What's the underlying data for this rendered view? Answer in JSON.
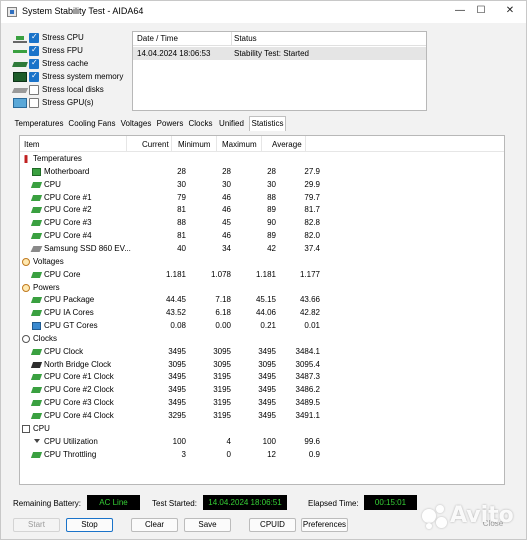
{
  "window": {
    "title": "System Stability Test - AIDA64",
    "controls": {
      "minimize": "—",
      "maximize": "☐",
      "close": "✕"
    }
  },
  "stress_options": [
    {
      "label": "Stress CPU",
      "checked": true,
      "icon": "cpu-icon"
    },
    {
      "label": "Stress FPU",
      "checked": true,
      "icon": "fpu-icon"
    },
    {
      "label": "Stress cache",
      "checked": true,
      "icon": "cache-icon"
    },
    {
      "label": "Stress system memory",
      "checked": true,
      "icon": "memory-icon"
    },
    {
      "label": "Stress local disks",
      "checked": false,
      "icon": "disk-icon"
    },
    {
      "label": "Stress GPU(s)",
      "checked": false,
      "icon": "gpu-icon"
    }
  ],
  "status_log": {
    "headers": [
      "Date / Time",
      "Status"
    ],
    "rows": [
      {
        "datetime": "14.04.2024 18:06:53",
        "status": "Stability Test: Started"
      }
    ]
  },
  "tabs": [
    "Temperatures",
    "Cooling Fans",
    "Voltages",
    "Powers",
    "Clocks",
    "Unified",
    "Statistics"
  ],
  "active_tab": "Statistics",
  "stats": {
    "headers": [
      "Item",
      "Current",
      "Minimum",
      "Maximum",
      "Average"
    ],
    "rows": [
      {
        "type": "group",
        "name": "Temperatures",
        "icon": "thermometer-icon"
      },
      {
        "type": "item",
        "name": "Motherboard",
        "icon": "motherboard-icon",
        "values": [
          "28",
          "28",
          "28",
          "27.9"
        ]
      },
      {
        "type": "item",
        "name": "CPU",
        "icon": "chip-icon",
        "values": [
          "30",
          "30",
          "30",
          "29.9"
        ]
      },
      {
        "type": "item",
        "name": "CPU Core #1",
        "icon": "chip-icon",
        "values": [
          "79",
          "46",
          "88",
          "79.7"
        ]
      },
      {
        "type": "item",
        "name": "CPU Core #2",
        "icon": "chip-icon",
        "values": [
          "81",
          "46",
          "89",
          "81.7"
        ]
      },
      {
        "type": "item",
        "name": "CPU Core #3",
        "icon": "chip-icon",
        "values": [
          "88",
          "45",
          "90",
          "82.8"
        ]
      },
      {
        "type": "item",
        "name": "CPU Core #4",
        "icon": "chip-icon",
        "values": [
          "81",
          "46",
          "89",
          "82.0"
        ]
      },
      {
        "type": "item",
        "name": "Samsung SSD 860 EV...",
        "icon": "ssd-icon",
        "values": [
          "40",
          "34",
          "42",
          "37.4"
        ]
      },
      {
        "type": "group",
        "name": "Voltages",
        "icon": "voltage-icon"
      },
      {
        "type": "item",
        "name": "CPU Core",
        "icon": "chip-icon",
        "values": [
          "1.181",
          "1.078",
          "1.181",
          "1.177"
        ]
      },
      {
        "type": "group",
        "name": "Powers",
        "icon": "power-icon"
      },
      {
        "type": "item",
        "name": "CPU Package",
        "icon": "chip-icon",
        "values": [
          "44.45",
          "7.18",
          "45.15",
          "43.66"
        ]
      },
      {
        "type": "item",
        "name": "CPU IA Cores",
        "icon": "chip-icon",
        "values": [
          "43.52",
          "6.18",
          "44.06",
          "42.82"
        ]
      },
      {
        "type": "item",
        "name": "CPU GT Cores",
        "icon": "gt-cores-icon",
        "values": [
          "0.08",
          "0.00",
          "0.21",
          "0.01"
        ]
      },
      {
        "type": "group",
        "name": "Clocks",
        "icon": "clock-icon"
      },
      {
        "type": "item",
        "name": "CPU Clock",
        "icon": "chip-icon",
        "values": [
          "3495",
          "3095",
          "3495",
          "3484.1"
        ]
      },
      {
        "type": "item",
        "name": "North Bridge Clock",
        "icon": "northbridge-icon",
        "values": [
          "3095",
          "3095",
          "3095",
          "3095.4"
        ]
      },
      {
        "type": "item",
        "name": "CPU Core #1 Clock",
        "icon": "chip-icon",
        "values": [
          "3495",
          "3195",
          "3495",
          "3487.3"
        ]
      },
      {
        "type": "item",
        "name": "CPU Core #2 Clock",
        "icon": "chip-icon",
        "values": [
          "3495",
          "3195",
          "3495",
          "3486.2"
        ]
      },
      {
        "type": "item",
        "name": "CPU Core #3 Clock",
        "icon": "chip-icon",
        "values": [
          "3495",
          "3195",
          "3495",
          "3489.5"
        ]
      },
      {
        "type": "item",
        "name": "CPU Core #4 Clock",
        "icon": "chip-icon",
        "values": [
          "3295",
          "3195",
          "3495",
          "3491.1"
        ]
      },
      {
        "type": "group",
        "name": "CPU",
        "icon": "cpu-group-icon"
      },
      {
        "type": "item",
        "name": "CPU Utilization",
        "icon": "hourglass-icon",
        "values": [
          "100",
          "4",
          "100",
          "99.6"
        ]
      },
      {
        "type": "item",
        "name": "CPU Throttling",
        "icon": "chip-icon",
        "values": [
          "3",
          "0",
          "12",
          "0.9"
        ]
      }
    ]
  },
  "status_bar": {
    "battery_label": "Remaining Battery:",
    "battery_value": "AC Line",
    "started_label": "Test Started:",
    "started_value": "14.04.2024 18:06:51",
    "elapsed_label": "Elapsed Time:",
    "elapsed_value": "00:15:01",
    "value_color": "#35d035"
  },
  "buttons": {
    "start": "Start",
    "stop": "Stop",
    "clear": "Clear",
    "save": "Save",
    "cpuid": "CPUID",
    "preferences": "Preferences",
    "close": "Close"
  },
  "watermark": {
    "text": "Avito"
  }
}
